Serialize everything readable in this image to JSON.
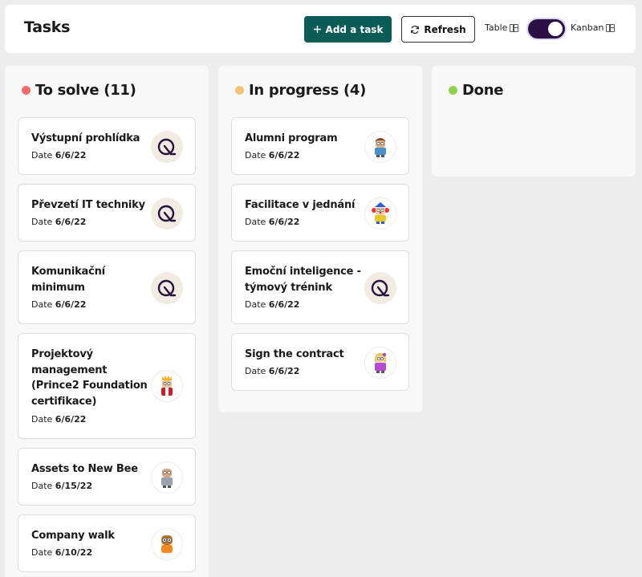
{
  "header": {
    "title": "Tasks",
    "add_task_label": "Add a task",
    "refresh_label": "Refresh",
    "view_table_label": "Table",
    "view_kanban_label": "Kanban",
    "view_mode": "Kanban"
  },
  "columns": [
    {
      "title": "To solve (11)",
      "dot_color": "#f26a6a",
      "cards": [
        {
          "title": "Výstupní prohlídka",
          "date_label": "Date",
          "date": "6/6/22",
          "avatar": "logo-q-icon"
        },
        {
          "title": "Převzetí IT techniky",
          "date_label": "Date",
          "date": "6/6/22",
          "avatar": "logo-q-icon"
        },
        {
          "title": "Komunikační minimum",
          "date_label": "Date",
          "date": "6/6/22",
          "avatar": "logo-q-icon"
        },
        {
          "title": "Projektový management (Prince2 Foundation certifikace)",
          "date_label": "Date",
          "date": "6/6/22",
          "avatar": "king-avatar-icon"
        },
        {
          "title": "Assets to New Bee",
          "date_label": "Date",
          "date": "6/15/22",
          "avatar": "gray-avatar-icon"
        },
        {
          "title": "Company walk",
          "date_label": "Date",
          "date": "6/10/22",
          "avatar": "owl-avatar-icon"
        }
      ]
    },
    {
      "title": "In progress (4)",
      "dot_color": "#f2c27a",
      "cards": [
        {
          "title": "Alumni program",
          "date_label": "Date",
          "date": "6/6/22",
          "avatar": "boy-avatar-icon"
        },
        {
          "title": "Facilitace v jednání",
          "date_label": "Date",
          "date": "6/6/22",
          "avatar": "clown-avatar-icon"
        },
        {
          "title": "Emoční inteligence - týmový trénink",
          "date_label": "Date",
          "date": "6/6/22",
          "avatar": "logo-q-icon"
        },
        {
          "title": "Sign the contract",
          "date_label": "Date",
          "date": "6/6/22",
          "avatar": "girl-avatar-icon"
        }
      ]
    },
    {
      "title": "Done",
      "dot_color": "#8fd14f",
      "cards": []
    }
  ]
}
